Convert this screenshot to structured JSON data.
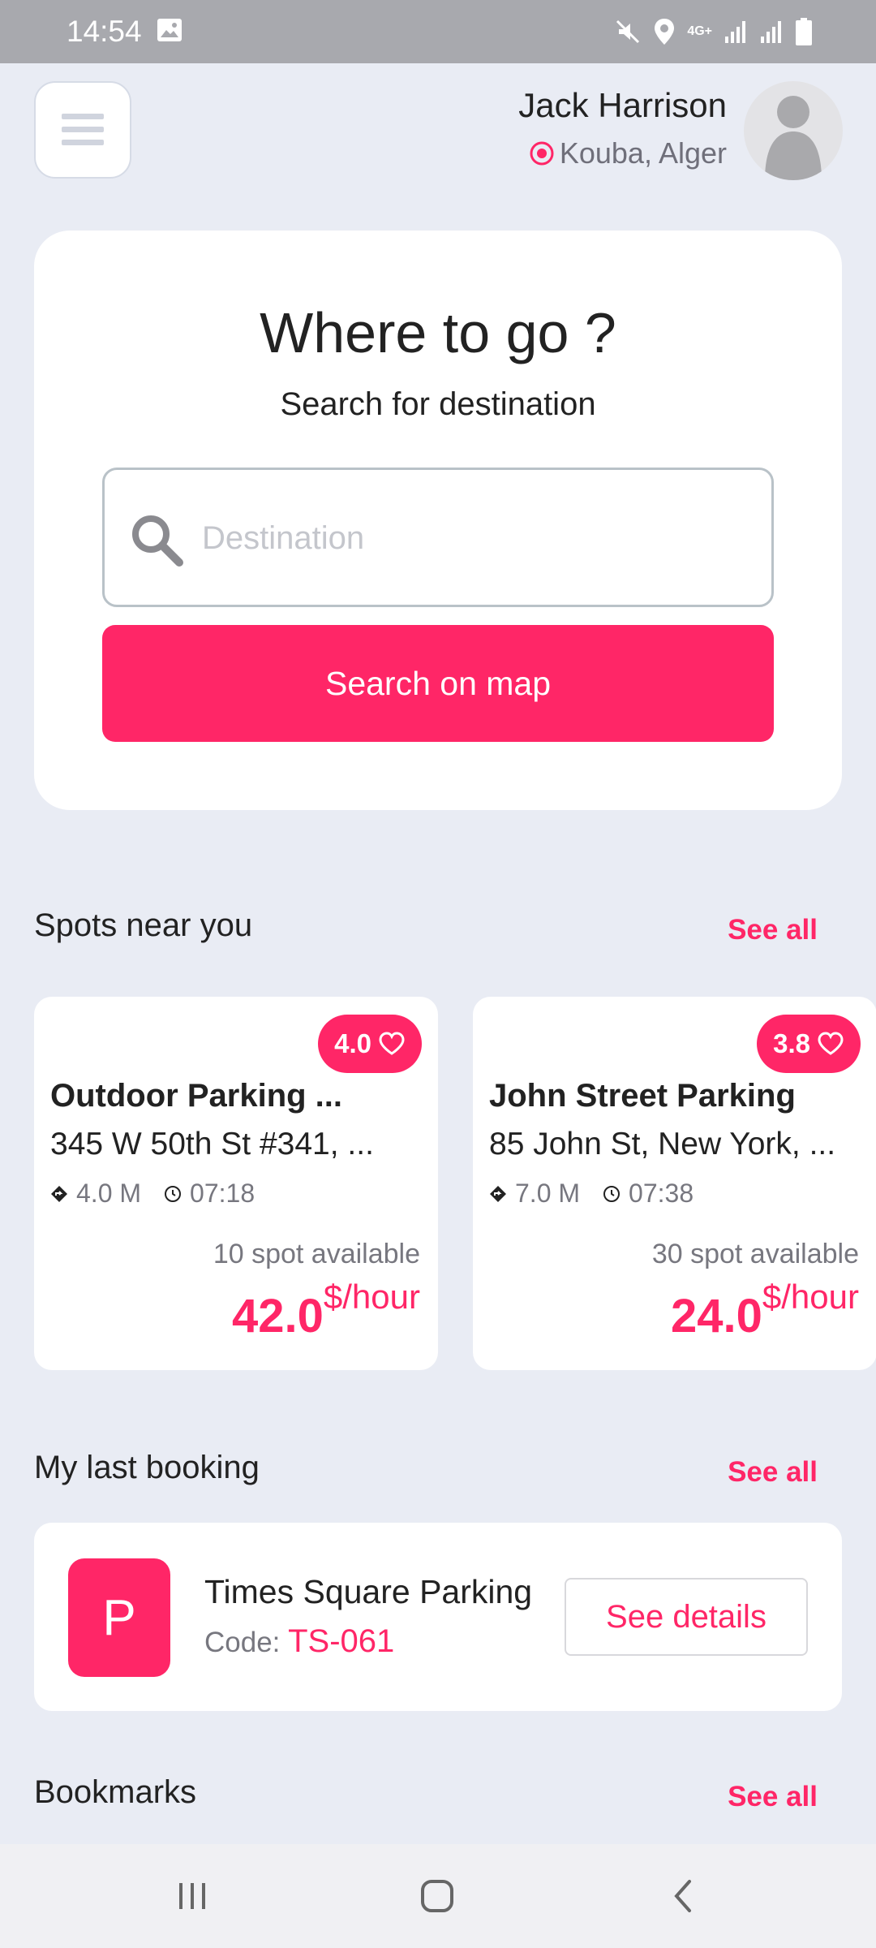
{
  "status_bar": {
    "time": "14:54",
    "network": "4G+",
    "icons": [
      "image-icon",
      "mute-icon",
      "location-icon",
      "signal-icon",
      "signal-icon",
      "battery-icon"
    ]
  },
  "header": {
    "menu_icon": "hamburger-icon",
    "user_name": "Jack Harrison",
    "location": "Kouba, Alger",
    "location_icon": "location-target-icon",
    "avatar_icon": "person-placeholder-icon"
  },
  "search": {
    "title": "Where to go ?",
    "subtitle": "Search for destination",
    "placeholder": "Destination",
    "value": "",
    "button_label": "Search on map"
  },
  "spots_section": {
    "title": "Spots near you",
    "see_all": "See all",
    "spots": [
      {
        "rating": "4.0",
        "name": "Outdoor Parking ...",
        "address": "345 W 50th St #341, ...",
        "distance": "4.0 M",
        "time": "07:18",
        "availability": "10 spot available",
        "price": "42.0",
        "price_unit": "$/hour"
      },
      {
        "rating": "3.8",
        "name": "John Street Parking",
        "address": "85 John St, New York, ...",
        "distance": "7.0 M",
        "time": "07:38",
        "availability": "30 spot available",
        "price": "24.0",
        "price_unit": "$/hour"
      }
    ]
  },
  "booking_section": {
    "title": "My last booking",
    "see_all": "See all",
    "booking": {
      "logo_letter": "P",
      "name": "Times Square Parking",
      "code_label": "Code: ",
      "code": "TS-061",
      "details_button": "See details"
    }
  },
  "bookmarks_section": {
    "title": "Bookmarks",
    "see_all": "See all"
  },
  "colors": {
    "accent": "#ff2667",
    "background": "#e9ecf4",
    "card": "#ffffff"
  },
  "nav": {
    "icons": [
      "recent-apps-icon",
      "home-icon",
      "back-icon"
    ]
  }
}
